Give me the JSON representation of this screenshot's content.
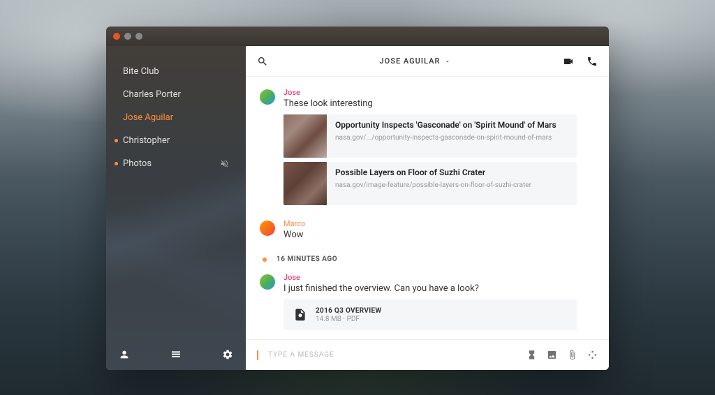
{
  "sidebar": {
    "items": [
      {
        "label": "Bite Club",
        "active": false,
        "unread": false,
        "muted": false
      },
      {
        "label": "Charles Porter",
        "active": false,
        "unread": false,
        "muted": false
      },
      {
        "label": "Jose Aguilar",
        "active": true,
        "unread": false,
        "muted": false
      },
      {
        "label": "Christopher",
        "active": false,
        "unread": true,
        "muted": false
      },
      {
        "label": "Photos",
        "active": false,
        "unread": true,
        "muted": true
      }
    ]
  },
  "header": {
    "title": "JOSE AGUILAR"
  },
  "messages": [
    {
      "sender": "Jose",
      "sender_style": "pink",
      "text": "These look interesting",
      "links": [
        {
          "title": "Opportunity Inspects 'Gasconade' on 'Spirit Mound' of Mars",
          "url": "nasa.gov/.../opportunity-inspects-gasconade-on-spirit-mound-of-mars"
        },
        {
          "title": "Possible Layers on Floor of Suzhi Crater",
          "url": "nasa.gov/image-feature/possible-layers-on-floor-of-suzhi-crater"
        }
      ]
    },
    {
      "sender": "Marco",
      "sender_style": "orange",
      "text": "Wow"
    }
  ],
  "separator": {
    "label": "16 MINUTES AGO"
  },
  "messages2": [
    {
      "sender": "Jose",
      "sender_style": "pink",
      "text": "I just finished the overview. Can you have a look?",
      "file": {
        "name": "2016 Q3 OVERVIEW",
        "size": "14.8 MB",
        "type": "PDF"
      }
    }
  ],
  "composer": {
    "placeholder": "TYPE A MESSAGE"
  }
}
